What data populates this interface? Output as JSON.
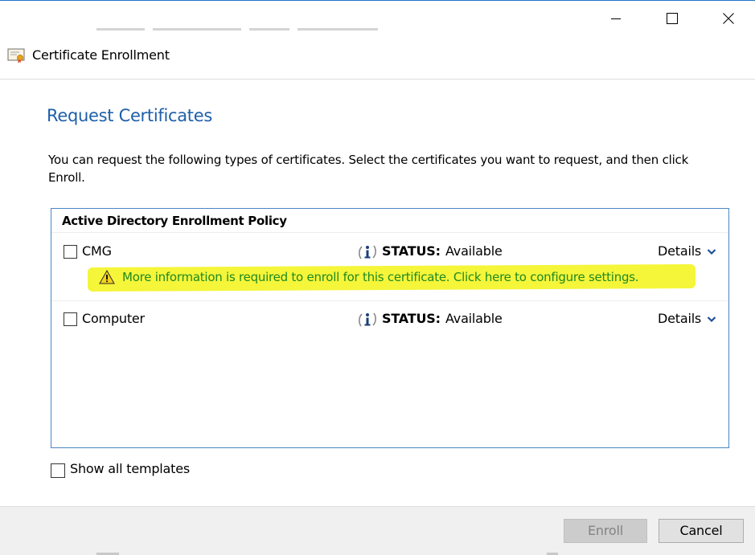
{
  "window": {
    "title": "Certificate Enrollment",
    "accent_color": "#1f74c9",
    "controls": [
      "minimize-icon",
      "maximize-icon",
      "close-icon"
    ]
  },
  "page": {
    "heading": "Request Certificates",
    "heading_color": "#1e5fa8",
    "description": "You can request the following types of certificates. Select the certificates you want to request, and then click Enroll."
  },
  "policy": {
    "header": "Active Directory Enrollment Policy",
    "border_color": "#4a87c4",
    "items": [
      {
        "name": "CMG",
        "checked": false,
        "status_label": "STATUS:",
        "status_value": "Available",
        "details_label": "Details",
        "icon": "info-icon",
        "warning": "More information is required to enroll for this certificate. Click here to configure settings.",
        "warning_color": "#1f8a1f",
        "highlight_color": "#f5f53a"
      },
      {
        "name": "Computer",
        "checked": false,
        "status_label": "STATUS:",
        "status_value": "Available",
        "details_label": "Details",
        "icon": "info-icon"
      }
    ]
  },
  "options": {
    "show_all_label": "Show all templates",
    "show_all_checked": false
  },
  "footer": {
    "enroll_label": "Enroll",
    "enroll_enabled": false,
    "cancel_label": "Cancel"
  }
}
